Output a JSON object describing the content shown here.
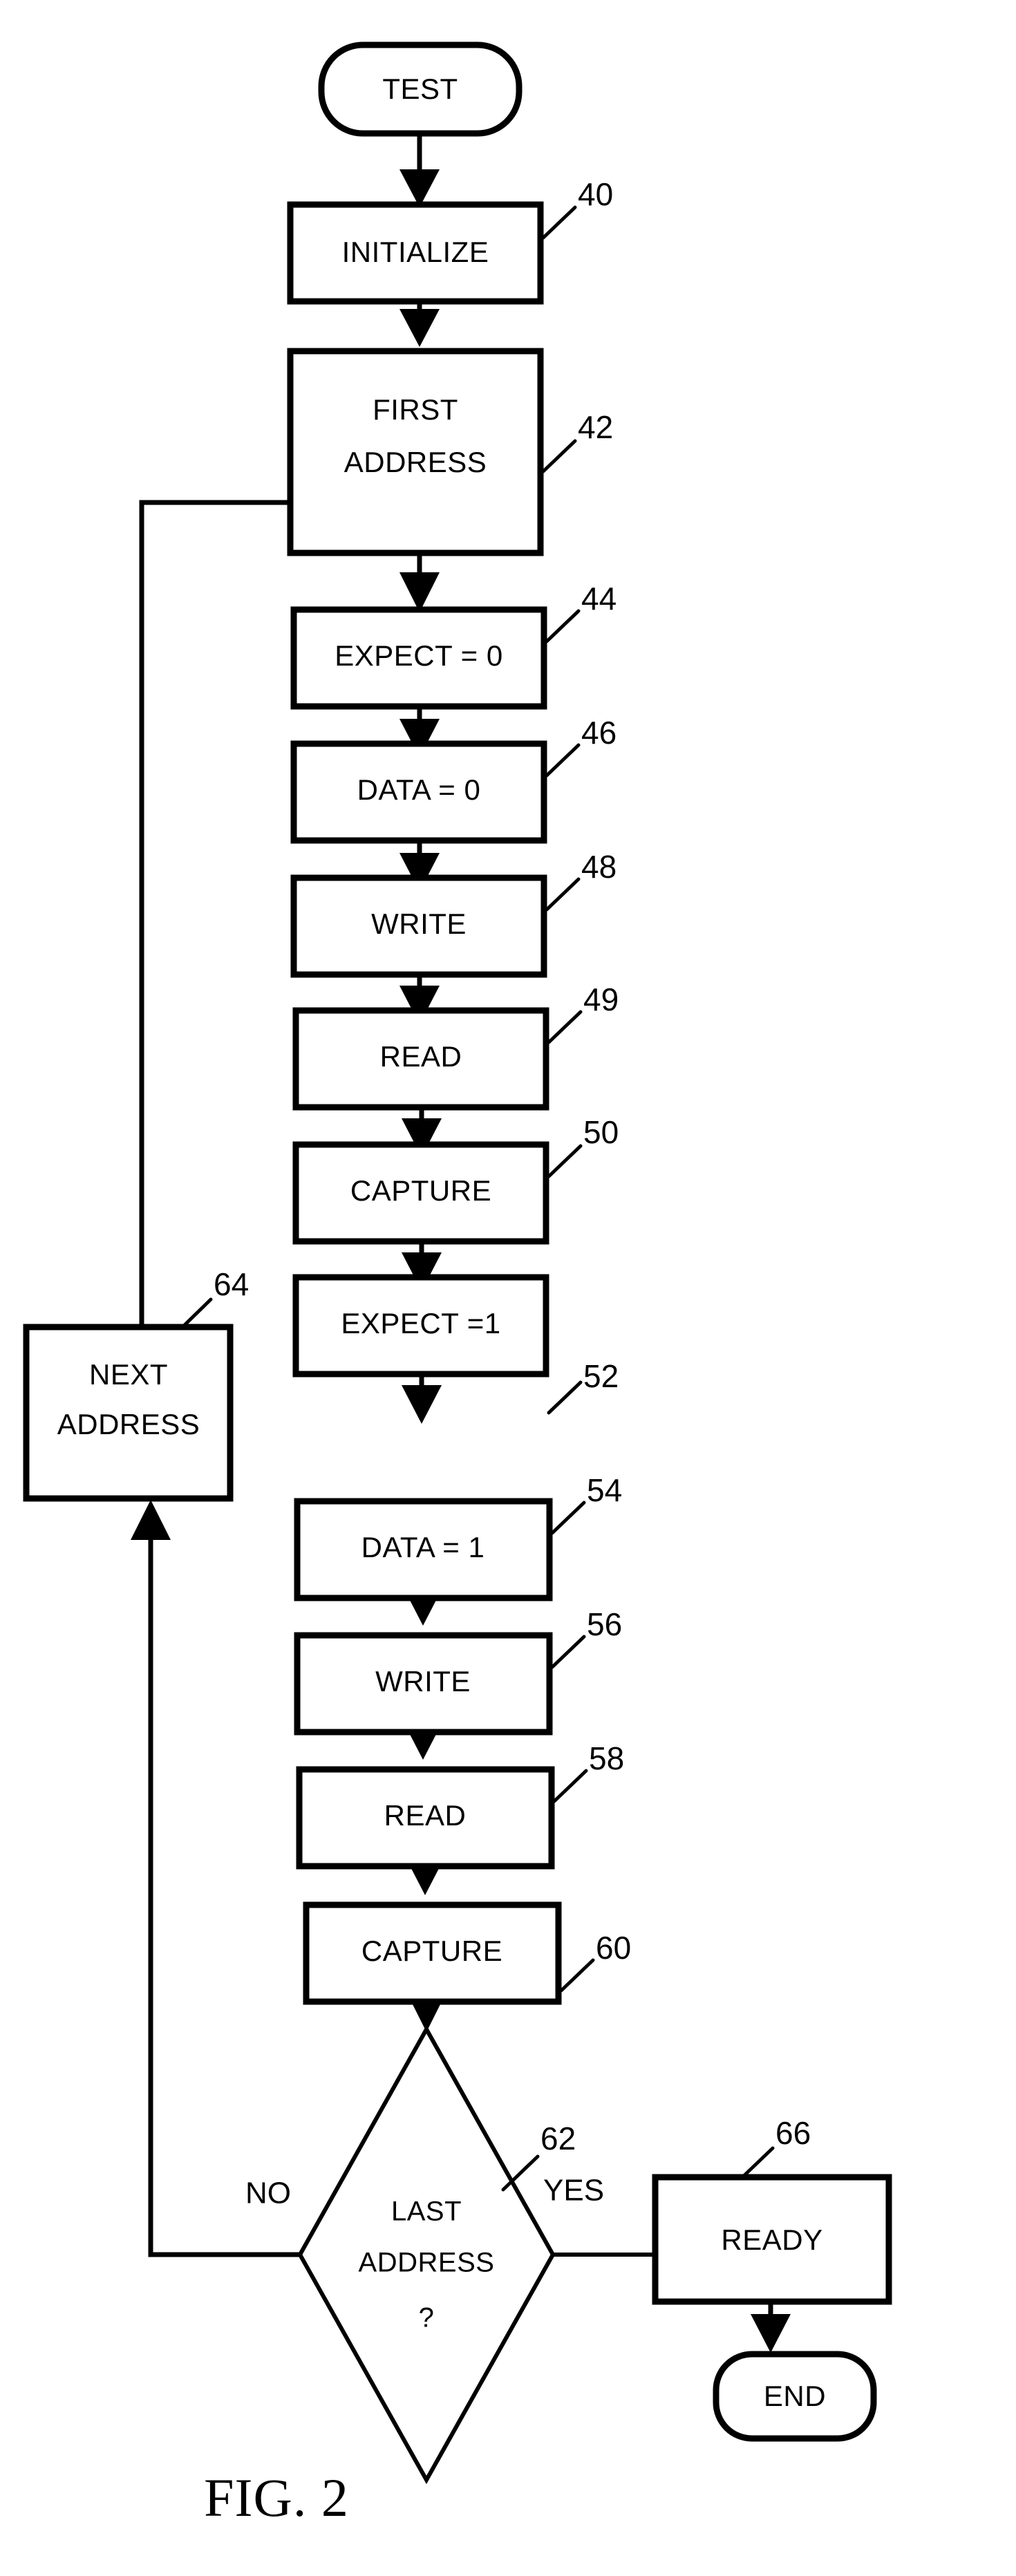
{
  "figure": {
    "caption": "FIG. 2",
    "type": "patent-flowchart"
  },
  "chart_data": {
    "type": "diagram",
    "title": "FIG. 2",
    "nodes": [
      {
        "id": "test",
        "label": "TEST",
        "shape": "terminal",
        "ref": null
      },
      {
        "id": "initialize",
        "label": "INITIALIZE",
        "shape": "process",
        "ref": "40"
      },
      {
        "id": "first_addr",
        "label": "FIRST\nADDRESS",
        "shape": "process",
        "ref": "42"
      },
      {
        "id": "expect0",
        "label": "EXPECT = 0",
        "shape": "process",
        "ref": "44"
      },
      {
        "id": "data0",
        "label": "DATA = 0",
        "shape": "process",
        "ref": "46"
      },
      {
        "id": "write0",
        "label": "WRITE",
        "shape": "process",
        "ref": "48"
      },
      {
        "id": "read0",
        "label": "READ",
        "shape": "process",
        "ref": "49"
      },
      {
        "id": "capture0",
        "label": "CAPTURE",
        "shape": "process",
        "ref": "50"
      },
      {
        "id": "expect1",
        "label": "EXPECT =1",
        "shape": "process",
        "ref": "52"
      },
      {
        "id": "data1",
        "label": "DATA = 1",
        "shape": "process",
        "ref": "54"
      },
      {
        "id": "write1",
        "label": "WRITE",
        "shape": "process",
        "ref": "56"
      },
      {
        "id": "read1",
        "label": "READ",
        "shape": "process",
        "ref": "58"
      },
      {
        "id": "capture1",
        "label": "CAPTURE",
        "shape": "process",
        "ref": "60"
      },
      {
        "id": "last_addr",
        "label": "LAST\nADDRESS\n?",
        "shape": "decision",
        "ref": "62"
      },
      {
        "id": "next_addr",
        "label": "NEXT\nADDRESS",
        "shape": "process",
        "ref": "64"
      },
      {
        "id": "ready",
        "label": "READY",
        "shape": "process",
        "ref": "66"
      },
      {
        "id": "end",
        "label": "END",
        "shape": "terminal",
        "ref": null
      }
    ],
    "edges": [
      {
        "from": "test",
        "to": "initialize",
        "label": ""
      },
      {
        "from": "initialize",
        "to": "first_addr",
        "label": ""
      },
      {
        "from": "first_addr",
        "to": "expect0",
        "label": ""
      },
      {
        "from": "expect0",
        "to": "data0",
        "label": ""
      },
      {
        "from": "data0",
        "to": "write0",
        "label": ""
      },
      {
        "from": "write0",
        "to": "read0",
        "label": ""
      },
      {
        "from": "read0",
        "to": "capture0",
        "label": ""
      },
      {
        "from": "capture0",
        "to": "expect1",
        "label": ""
      },
      {
        "from": "expect1",
        "to": "data1",
        "label": ""
      },
      {
        "from": "data1",
        "to": "write1",
        "label": ""
      },
      {
        "from": "write1",
        "to": "read1",
        "label": ""
      },
      {
        "from": "read1",
        "to": "capture1",
        "label": ""
      },
      {
        "from": "capture1",
        "to": "last_addr",
        "label": ""
      },
      {
        "from": "last_addr",
        "to": "next_addr",
        "label": "NO"
      },
      {
        "from": "last_addr",
        "to": "ready",
        "label": "YES"
      },
      {
        "from": "next_addr",
        "to": "expect0",
        "label": ""
      },
      {
        "from": "ready",
        "to": "end",
        "label": ""
      }
    ],
    "branch_labels": {
      "no": "NO",
      "yes": "YES"
    },
    "reference_numerals": [
      "40",
      "42",
      "44",
      "46",
      "48",
      "49",
      "50",
      "52",
      "54",
      "56",
      "58",
      "60",
      "62",
      "64",
      "66"
    ],
    "colors": {
      "stroke": "#000000",
      "fill": "#ffffff",
      "text": "#000000"
    }
  },
  "nodes": {
    "test": {
      "label": "TEST"
    },
    "initialize": {
      "label": "INITIALIZE",
      "ref": "40"
    },
    "first_addr": {
      "line1": "FIRST",
      "line2": "ADDRESS",
      "ref": "42"
    },
    "expect0": {
      "label": "EXPECT = 0",
      "ref": "44"
    },
    "data0": {
      "label": "DATA = 0",
      "ref": "46"
    },
    "write0": {
      "label": "WRITE",
      "ref": "48"
    },
    "read0": {
      "label": "READ",
      "ref": "49"
    },
    "capture0": {
      "label": "CAPTURE",
      "ref": "50"
    },
    "expect1": {
      "label": "EXPECT =1",
      "ref": "52"
    },
    "data1": {
      "label": "DATA = 1",
      "ref": "54"
    },
    "write1": {
      "label": "WRITE",
      "ref": "56"
    },
    "read1": {
      "label": "READ",
      "ref": "58"
    },
    "capture1": {
      "label": "CAPTURE",
      "ref": "60"
    },
    "last_addr": {
      "line1": "LAST",
      "line2": "ADDRESS",
      "line3": "?",
      "ref": "62"
    },
    "next_addr": {
      "line1": "NEXT",
      "line2": "ADDRESS",
      "ref": "64"
    },
    "ready": {
      "label": "READY",
      "ref": "66"
    },
    "end": {
      "label": "END"
    }
  },
  "branches": {
    "no": "NO",
    "yes": "YES"
  }
}
